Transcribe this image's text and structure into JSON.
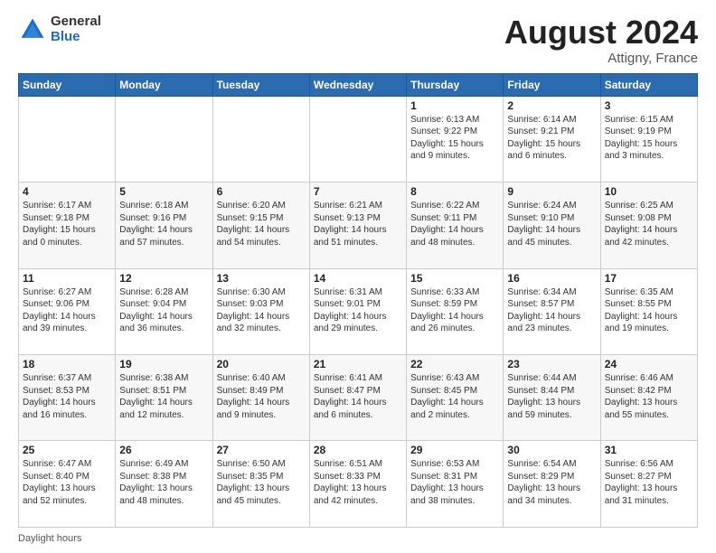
{
  "header": {
    "logo_general": "General",
    "logo_blue": "Blue",
    "month_title": "August 2024",
    "subtitle": "Attigny, France"
  },
  "days_of_week": [
    "Sunday",
    "Monday",
    "Tuesday",
    "Wednesday",
    "Thursday",
    "Friday",
    "Saturday"
  ],
  "weeks": [
    [
      {
        "day": "",
        "info": ""
      },
      {
        "day": "",
        "info": ""
      },
      {
        "day": "",
        "info": ""
      },
      {
        "day": "",
        "info": ""
      },
      {
        "day": "1",
        "info": "Sunrise: 6:13 AM\nSunset: 9:22 PM\nDaylight: 15 hours and 9 minutes."
      },
      {
        "day": "2",
        "info": "Sunrise: 6:14 AM\nSunset: 9:21 PM\nDaylight: 15 hours and 6 minutes."
      },
      {
        "day": "3",
        "info": "Sunrise: 6:15 AM\nSunset: 9:19 PM\nDaylight: 15 hours and 3 minutes."
      }
    ],
    [
      {
        "day": "4",
        "info": "Sunrise: 6:17 AM\nSunset: 9:18 PM\nDaylight: 15 hours and 0 minutes."
      },
      {
        "day": "5",
        "info": "Sunrise: 6:18 AM\nSunset: 9:16 PM\nDaylight: 14 hours and 57 minutes."
      },
      {
        "day": "6",
        "info": "Sunrise: 6:20 AM\nSunset: 9:15 PM\nDaylight: 14 hours and 54 minutes."
      },
      {
        "day": "7",
        "info": "Sunrise: 6:21 AM\nSunset: 9:13 PM\nDaylight: 14 hours and 51 minutes."
      },
      {
        "day": "8",
        "info": "Sunrise: 6:22 AM\nSunset: 9:11 PM\nDaylight: 14 hours and 48 minutes."
      },
      {
        "day": "9",
        "info": "Sunrise: 6:24 AM\nSunset: 9:10 PM\nDaylight: 14 hours and 45 minutes."
      },
      {
        "day": "10",
        "info": "Sunrise: 6:25 AM\nSunset: 9:08 PM\nDaylight: 14 hours and 42 minutes."
      }
    ],
    [
      {
        "day": "11",
        "info": "Sunrise: 6:27 AM\nSunset: 9:06 PM\nDaylight: 14 hours and 39 minutes."
      },
      {
        "day": "12",
        "info": "Sunrise: 6:28 AM\nSunset: 9:04 PM\nDaylight: 14 hours and 36 minutes."
      },
      {
        "day": "13",
        "info": "Sunrise: 6:30 AM\nSunset: 9:03 PM\nDaylight: 14 hours and 32 minutes."
      },
      {
        "day": "14",
        "info": "Sunrise: 6:31 AM\nSunset: 9:01 PM\nDaylight: 14 hours and 29 minutes."
      },
      {
        "day": "15",
        "info": "Sunrise: 6:33 AM\nSunset: 8:59 PM\nDaylight: 14 hours and 26 minutes."
      },
      {
        "day": "16",
        "info": "Sunrise: 6:34 AM\nSunset: 8:57 PM\nDaylight: 14 hours and 23 minutes."
      },
      {
        "day": "17",
        "info": "Sunrise: 6:35 AM\nSunset: 8:55 PM\nDaylight: 14 hours and 19 minutes."
      }
    ],
    [
      {
        "day": "18",
        "info": "Sunrise: 6:37 AM\nSunset: 8:53 PM\nDaylight: 14 hours and 16 minutes."
      },
      {
        "day": "19",
        "info": "Sunrise: 6:38 AM\nSunset: 8:51 PM\nDaylight: 14 hours and 12 minutes."
      },
      {
        "day": "20",
        "info": "Sunrise: 6:40 AM\nSunset: 8:49 PM\nDaylight: 14 hours and 9 minutes."
      },
      {
        "day": "21",
        "info": "Sunrise: 6:41 AM\nSunset: 8:47 PM\nDaylight: 14 hours and 6 minutes."
      },
      {
        "day": "22",
        "info": "Sunrise: 6:43 AM\nSunset: 8:45 PM\nDaylight: 14 hours and 2 minutes."
      },
      {
        "day": "23",
        "info": "Sunrise: 6:44 AM\nSunset: 8:44 PM\nDaylight: 13 hours and 59 minutes."
      },
      {
        "day": "24",
        "info": "Sunrise: 6:46 AM\nSunset: 8:42 PM\nDaylight: 13 hours and 55 minutes."
      }
    ],
    [
      {
        "day": "25",
        "info": "Sunrise: 6:47 AM\nSunset: 8:40 PM\nDaylight: 13 hours and 52 minutes."
      },
      {
        "day": "26",
        "info": "Sunrise: 6:49 AM\nSunset: 8:38 PM\nDaylight: 13 hours and 48 minutes."
      },
      {
        "day": "27",
        "info": "Sunrise: 6:50 AM\nSunset: 8:35 PM\nDaylight: 13 hours and 45 minutes."
      },
      {
        "day": "28",
        "info": "Sunrise: 6:51 AM\nSunset: 8:33 PM\nDaylight: 13 hours and 42 minutes."
      },
      {
        "day": "29",
        "info": "Sunrise: 6:53 AM\nSunset: 8:31 PM\nDaylight: 13 hours and 38 minutes."
      },
      {
        "day": "30",
        "info": "Sunrise: 6:54 AM\nSunset: 8:29 PM\nDaylight: 13 hours and 34 minutes."
      },
      {
        "day": "31",
        "info": "Sunrise: 6:56 AM\nSunset: 8:27 PM\nDaylight: 13 hours and 31 minutes."
      }
    ]
  ],
  "footer": {
    "daylight_hours_label": "Daylight hours"
  }
}
